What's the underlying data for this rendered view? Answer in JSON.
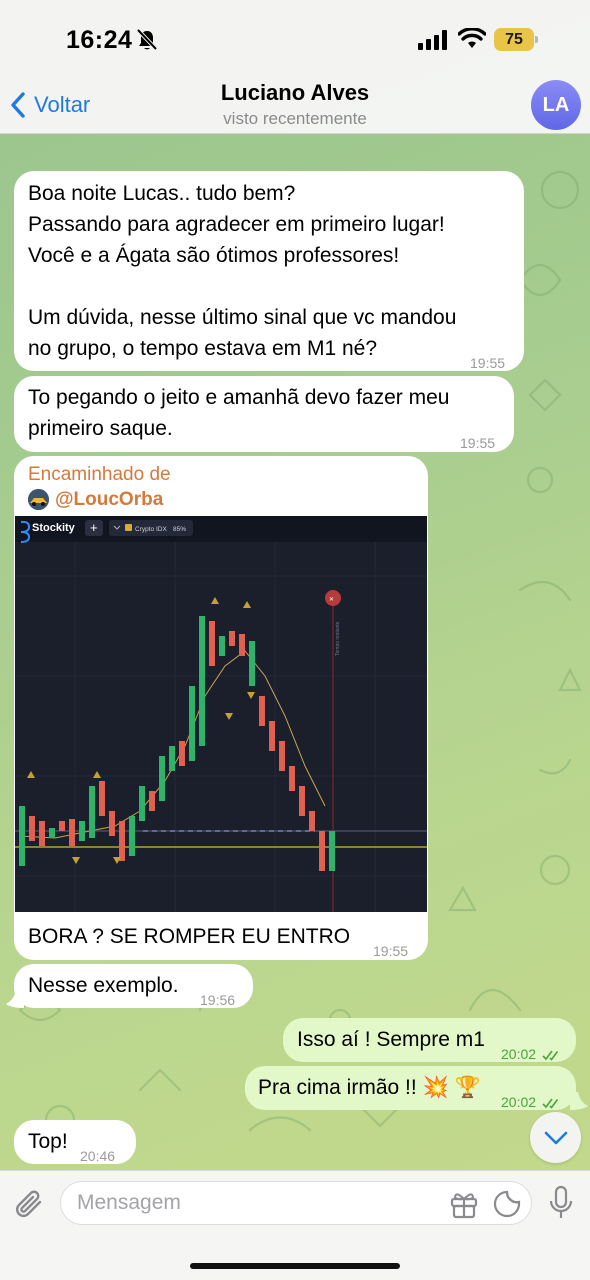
{
  "status": {
    "time": "16:24",
    "battery": "75"
  },
  "header": {
    "back_label": "Voltar",
    "title": "Luciano Alves",
    "subtitle": "visto recentemente",
    "avatar_initials": "LA"
  },
  "messages": [
    {
      "text": "Boa noite Lucas.. tudo bem?\nPassando para agradecer em primeiro lugar!\nVocê e a Ágata são ótimos professores!\n\nUm dúvida, nesse último sinal que vc mandou\nno grupo, o tempo estava em M1 né?",
      "time": "19:55"
    },
    {
      "text": "To pegando o jeito e amanhã devo fazer meu\nprimeiro saque.",
      "time": "19:55"
    },
    {
      "forwarded_label": "Encaminhado de",
      "forwarded_from": "@LoucOrba",
      "caption": "BORA ? SE ROMPER EU ENTRO",
      "time": "19:55",
      "image": {
        "brand": "Stockity",
        "plus": "+",
        "asset": "Crypto IDX",
        "payout": "85%",
        "marker": "Tempo restante"
      }
    },
    {
      "text": "Nesse exemplo.",
      "time": "19:56"
    },
    {
      "text": "Isso aí ! Sempre m1",
      "time": "20:02"
    },
    {
      "text": "Pra cima irmão !! 💥 🏆",
      "time": "20:02"
    },
    {
      "text": "Top!",
      "time": "20:46"
    }
  ],
  "composer": {
    "placeholder": "Mensagem"
  },
  "colors": {
    "accent": "#1f7ae0",
    "outgoing": "#e3f8c9",
    "incoming": "#ffffff",
    "forward": "#d6793a"
  },
  "icons": [
    "bell-off-icon",
    "signal-icon",
    "wifi-icon",
    "battery-icon",
    "chevron-left-icon",
    "chevron-down-icon",
    "paperclip-icon",
    "gift-icon",
    "sticker-icon",
    "microphone-icon",
    "double-check-icon"
  ]
}
